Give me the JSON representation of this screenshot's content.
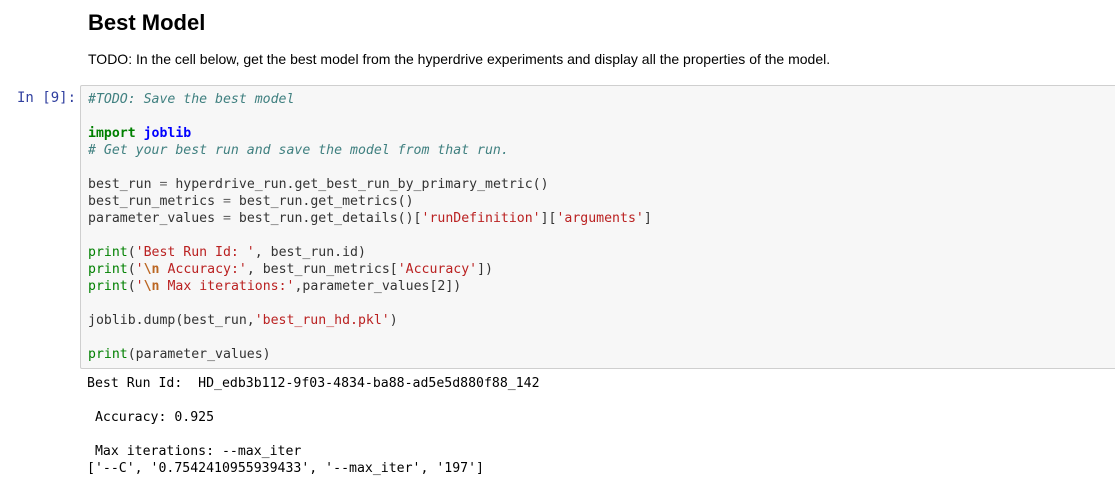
{
  "markdown": {
    "heading": "Best Model",
    "text": "TODO: In the cell below, get the best model from the hyperdrive experiments and display all the properties of the model."
  },
  "cell": {
    "prompt": "In [9]:",
    "code_lines": [
      "#TODO: Save the best model",
      "",
      "import joblib",
      "# Get your best run and save the model from that run.",
      "",
      "best_run = hyperdrive_run.get_best_run_by_primary_metric()",
      "best_run_metrics = best_run.get_metrics()",
      "parameter_values = best_run.get_details()['runDefinition']['arguments']",
      "",
      "print('Best Run Id: ', best_run.id)",
      "print('\\n Accuracy:', best_run_metrics['Accuracy'])",
      "print('\\n Max iterations:',parameter_values[2])",
      "",
      "joblib.dump(best_run,'best_run_hd.pkl')",
      "",
      "print(parameter_values)"
    ],
    "output_lines": [
      "Best Run Id:  HD_edb3b112-9f03-4834-ba88-ad5e5d880f88_142",
      "",
      " Accuracy: 0.925",
      "",
      " Max iterations: --max_iter",
      "['--C', '0.7542410955939433', '--max_iter', '197']"
    ]
  },
  "colors": {
    "prompt": "#303f9f",
    "input_background": "#f7f7f7",
    "input_border": "#cfcfcf",
    "comment": "#408080",
    "keyword": "#008000",
    "string": "#ba2121"
  }
}
